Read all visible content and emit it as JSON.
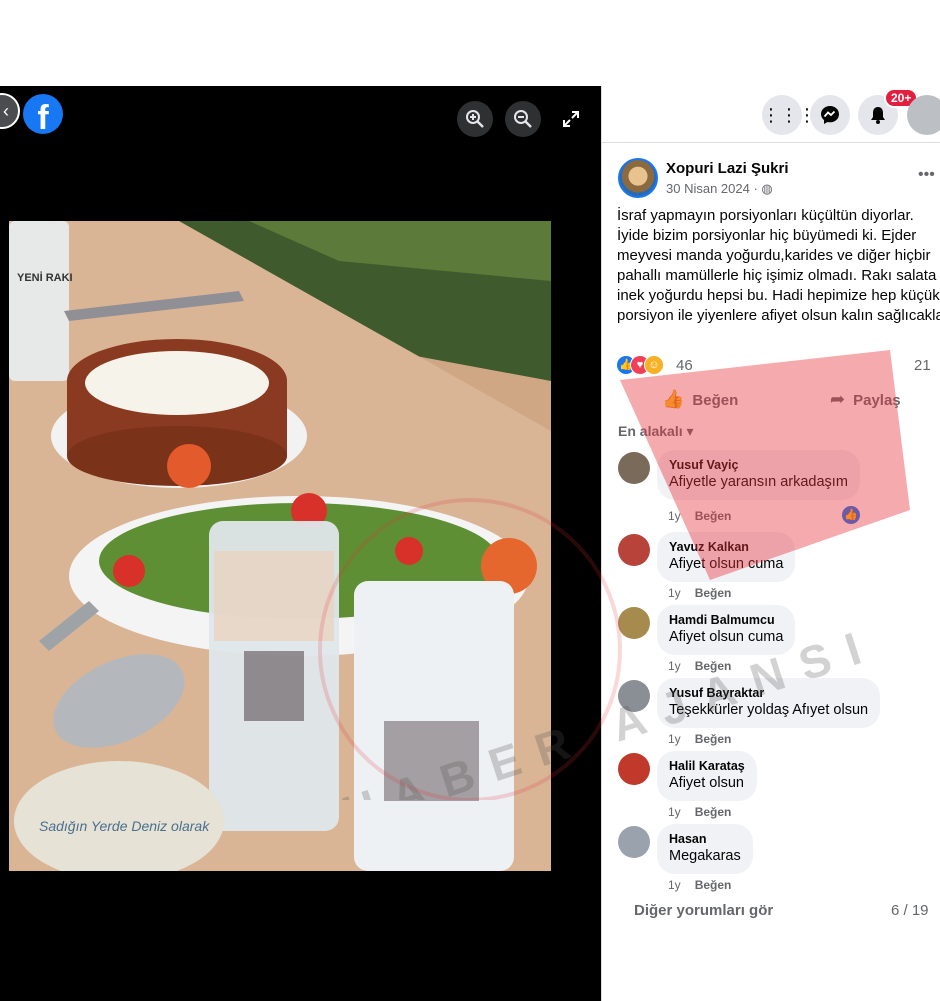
{
  "viewer": {
    "logo": "f",
    "buttons": [
      "zoom-in-icon",
      "zoom-out-icon",
      "fullscreen-icon"
    ]
  },
  "header": {
    "notification_badge": "20+",
    "icons": [
      "menu-grid-icon",
      "messenger-icon",
      "bell-icon",
      "account-avatar"
    ]
  },
  "post": {
    "author": "Xopuri Lazi Şukri",
    "date": "30 Nisan 2024 · ",
    "text": "İsraf yapmayın porsiyonları küçültün diyorlar.\nİyide bizim porsiyonlar hiç büyümedi ki. Ejder\nmeyvesi manda yoğurdu,karides ve diğer hiçbir\npahallı mamüllerle hiç işimiz olmadı. Rakı salata\ninek yoğurdu hepsi bu. Hadi hepimize hep küçük\nporsiyon ile yiyenlere afiyet olsun kalın sağlıcakla",
    "reaction_count": "46",
    "comment_count": "21",
    "actions": {
      "like": "Beğen",
      "share": "Paylaş"
    },
    "sort_label": "En alakalı"
  },
  "comments": [
    {
      "name": "Yusuf Vayiç",
      "text": "Afiyetle yaransın arkadaşım",
      "age": "1y",
      "like": "Beğen",
      "avatar_color": "#7a6a5a"
    },
    {
      "name": "Yavuz Kalkan",
      "text": "Afiyet olsun cuma",
      "age": "1y",
      "like": "Beğen",
      "avatar_color": "#b8433b"
    },
    {
      "name": "Hamdi Balmumcu",
      "text": "Afiyet olsun cuma",
      "age": "1y",
      "like": "Beğen",
      "avatar_color": "#a68a4e"
    },
    {
      "name": "Yusuf Bayraktar",
      "text": "Teşekkürler yoldaş Afıyet olsun",
      "age": "1y",
      "like": "Beğen",
      "avatar_color": "#8a8f96"
    },
    {
      "name": "Halil Karataş",
      "text": "Afiyet olsun",
      "age": "1y",
      "like": "Beğen",
      "avatar_color": "#c0392b"
    },
    {
      "name": "Hasan",
      "text": "Megakaras",
      "age": "1y",
      "like": "Beğen",
      "avatar_color": "#9aa3ad"
    }
  ],
  "footer": {
    "more_comments": "Diğer yorumları gör",
    "pager": "6 / 19"
  },
  "photo": {
    "label_text": "YENİ RAKI",
    "plate_text": "Sadığın Yerde Deniz olarak"
  },
  "watermark": {
    "text": "HABER AJANSI"
  }
}
